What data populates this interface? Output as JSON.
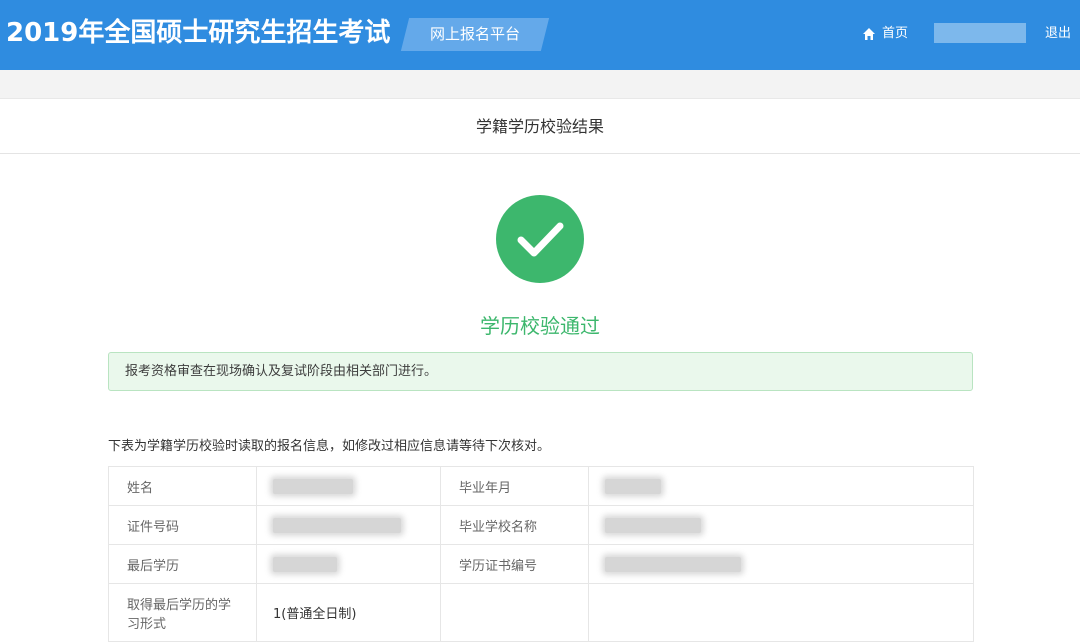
{
  "header": {
    "title": "2019年全国硕士研究生招生考试",
    "platform": "网上报名平台",
    "home_label": "首页",
    "logout_label": "退出"
  },
  "page": {
    "title": "学籍学历校验结果"
  },
  "result": {
    "status_text": "学历校验通过",
    "notice": "报考资格审查在现场确认及复试阶段由相关部门进行。",
    "caption": "下表为学籍学历校验时读取的报名信息，如修改过相应信息请等待下次核对。"
  },
  "table": {
    "name_label": "姓名",
    "grad_date_label": "毕业年月",
    "id_label": "证件号码",
    "school_label": "毕业学校名称",
    "degree_label": "最后学历",
    "cert_label": "学历证书编号",
    "study_mode_label": "取得最后学历的学习形式",
    "study_mode_value": "1(普通全日制)"
  },
  "colors": {
    "header_bg": "#2f8ce0",
    "success_green": "#3db76d",
    "notice_bg": "#eaf8ec"
  },
  "icons": {
    "home": "home-icon",
    "success": "check-circle-icon"
  }
}
